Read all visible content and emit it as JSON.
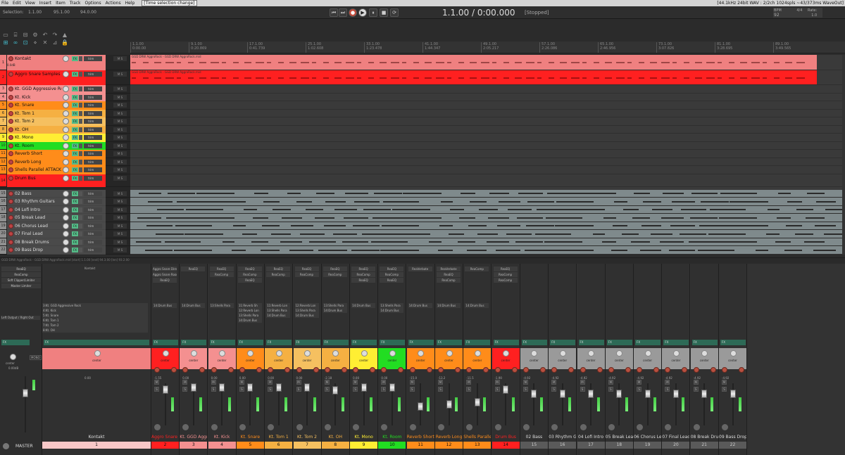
{
  "menubar": {
    "items": [
      "File",
      "Edit",
      "View",
      "Insert",
      "Item",
      "Track",
      "Options",
      "Actions",
      "Help"
    ],
    "status": "[Time selection change]",
    "right_info": "[44.1kHz 24bit WAV : 2/2ch 1024spls ~43/373ms WaveOut]"
  },
  "transport": {
    "selection_label": "Selection:",
    "sel_start": "1.1.00",
    "sel_end": "95.1.00",
    "sel_length": "94.0.00",
    "time": "1.1.00 / 0:00.000",
    "state": "[Stopped]",
    "bpm_label": "BPM",
    "bpm": "92",
    "timesig": "4/4",
    "rate_label": "Rate:",
    "rate": "1.0"
  },
  "ruler": {
    "marks": [
      {
        "bar": "1.1.00",
        "time": "0:00.00"
      },
      {
        "bar": "9.1.00",
        "time": "0:20.869"
      },
      {
        "bar": "17.1.00",
        "time": "0:41.739"
      },
      {
        "bar": "25.1.00",
        "time": "1:02.608"
      },
      {
        "bar": "33.1.00",
        "time": "1:23.478"
      },
      {
        "bar": "41.1.00",
        "time": "1:44.347"
      },
      {
        "bar": "49.1.00",
        "time": "2:05.217"
      },
      {
        "bar": "57.1.00",
        "time": "2:26.086"
      },
      {
        "bar": "65.1.00",
        "time": "2:46.956"
      },
      {
        "bar": "73.1.00",
        "time": "3:07.826"
      },
      {
        "bar": "81.1.00",
        "time": "3:28.695"
      },
      {
        "bar": "89.1.00",
        "time": "3:49.565"
      }
    ]
  },
  "tracks": [
    {
      "num": "1",
      "name": "Kontakt",
      "color": "#f08080",
      "sub": "0.0dB",
      "item": "GGD DRW AggroRock - GGD DRW AggroRock.mid"
    },
    {
      "num": "2",
      "name": "Aggro Snare Samples",
      "color": "#ff2020",
      "item": "GGD DRW AggroRock - GGD DRW AggroRock.mid"
    },
    {
      "num": "3",
      "name": "Kt. GGD Aggressive Rock",
      "color": "#f49090"
    },
    {
      "num": "4",
      "name": "Kt. Kick",
      "color": "#f49090"
    },
    {
      "num": "5",
      "name": "Kt. Snare",
      "color": "#ff8c1a"
    },
    {
      "num": "6",
      "name": "Kt. Tom 1",
      "color": "#f5b042"
    },
    {
      "num": "7",
      "name": "Kt. Tom 2",
      "color": "#f5c060"
    },
    {
      "num": "8",
      "name": "Kt. OH",
      "color": "#f5b042"
    },
    {
      "num": "9",
      "name": "Kt. Mono",
      "color": "#ffee33"
    },
    {
      "num": "10",
      "name": "Kt. Room",
      "color": "#22dd22"
    },
    {
      "num": "11",
      "name": "Reverb Short",
      "color": "#ff8c1a"
    },
    {
      "num": "12",
      "name": "Reverb Long",
      "color": "#ff8c1a"
    },
    {
      "num": "13",
      "name": "Shells Parallel ATTACK",
      "color": "#ff8c1a"
    },
    {
      "num": "14",
      "name": "Drum Bus",
      "color": "#ff2020"
    },
    {
      "num": "15",
      "name": "02 Bass",
      "color": "#8f8f8f"
    },
    {
      "num": "16",
      "name": "03 Rhythm Guitars",
      "color": "#8f8f8f"
    },
    {
      "num": "17",
      "name": "04 Lofi Intro",
      "color": "#8f8f8f"
    },
    {
      "num": "18",
      "name": "05 Break Lead",
      "color": "#8f8f8f"
    },
    {
      "num": "19",
      "name": "06 Chorus Lead",
      "color": "#8f8f8f"
    },
    {
      "num": "20",
      "name": "07 Final Lead",
      "color": "#8f8f8f"
    },
    {
      "num": "21",
      "name": "08 Break Drums",
      "color": "#8f8f8f"
    },
    {
      "num": "22",
      "name": "09 Bass Drop",
      "color": "#8f8f8f"
    }
  ],
  "track_controls": {
    "fx": "FX",
    "env": "trim",
    "ms": "M S"
  },
  "hscroll_text": "GGD DRW AggroRock - GGD DRW AggroRock.mid [start] 1.1.00 [end] 94.3.00 [len] 93.2.00",
  "mixer": {
    "master": {
      "fx": [
        "ReaEQ",
        "ReaComp",
        "Soft Clipper/Limiter",
        "Master Limiter"
      ],
      "output": "Left Output / Right Out",
      "fx_label": "FX",
      "pan": "center",
      "mono": "MONO",
      "vol": "0.00dB",
      "name": "MASTER"
    },
    "kontakt": {
      "sends": [
        "3:Kt. GGD Aggressive Rock",
        "4:Kt. Kick",
        "5:Kt. Snare",
        "6:Kt. Tom 1",
        "7:Kt. Tom 2",
        "8:Kt. OH"
      ],
      "vol": "0.00"
    },
    "strips": [
      {
        "name": "Aggro Snare S.",
        "num": "2",
        "fx": [
          "Aggro Snare Direc",
          "Aggro Snare Room",
          "ReaEQ"
        ],
        "sends": [
          "14:Drum Bus"
        ],
        "vol": "-1.55"
      },
      {
        "name": "Kt. GGD Aggre",
        "num": "3",
        "fx": [
          "ReaEQ"
        ],
        "sends": [
          "14:Drum Bus"
        ],
        "vol": "0.00"
      },
      {
        "name": "Kt. Kick",
        "num": "4",
        "fx": [
          "ReaEQ",
          "ReaComp"
        ],
        "sends": [
          "13:Shells Para"
        ],
        "vol": "0.00"
      },
      {
        "name": "Kt. Snare",
        "num": "5",
        "fx": [
          "ReaEQ",
          "ReaComp",
          "ReaEQ"
        ],
        "sends": [
          "11:Reverb Sh",
          "12:Reverb Lon",
          "13:Shells Para",
          "14:Drum Bus"
        ],
        "vol": "0.00"
      },
      {
        "name": "Kt. Tom 1",
        "num": "6",
        "fx": [
          "ReaEQ",
          "ReaComp"
        ],
        "sends": [
          "11:Reverb Lon",
          "13:Shells Para",
          "14:Drum Bus"
        ],
        "vol": "0.00"
      },
      {
        "name": "Kt. Tom 2",
        "num": "7",
        "fx": [
          "ReaEQ",
          "ReaComp"
        ],
        "sends": [
          "12:Reverb Lon",
          "13:Shells Para",
          "14:Drum Bus"
        ],
        "vol": "0.00"
      },
      {
        "name": "Kt. OH",
        "num": "8",
        "fx": [
          "ReaEQ",
          "ReaComp"
        ],
        "sends": [
          "13:Shells Para",
          "14:Drum Bus"
        ],
        "vol": "-2.18"
      },
      {
        "name": "Kt. Mono",
        "num": "9",
        "fx": [
          "ReaEQ",
          "ReaComp",
          "ReaEQ"
        ],
        "sends": [
          "14:Drum Bus"
        ],
        "vol": "0.00"
      },
      {
        "name": "Kt. Room",
        "num": "10",
        "fx": [
          "ReaEQ",
          "ReaComp",
          "ReaEQ"
        ],
        "sends": [
          "13:Shells Para",
          "14:Drum Bus"
        ],
        "vol": "0.00"
      },
      {
        "name": "Reverb Short",
        "num": "11",
        "fx": [
          "ReaVerbate"
        ],
        "sends": [
          "14:Drum Bus"
        ],
        "vol": "-15.0"
      },
      {
        "name": "Reverb Long",
        "num": "12",
        "fx": [
          "ReaVerbate",
          "ReaEQ",
          "ReaComp"
        ],
        "sends": [
          "14:Drum Bus"
        ],
        "vol": "-13.2"
      },
      {
        "name": "Shells Parallel",
        "num": "13",
        "fx": [
          "ReaComp"
        ],
        "sends": [
          "14:Drum Bus"
        ],
        "vol": "-11.5"
      },
      {
        "name": "Drum Bus",
        "num": "14",
        "fx": [
          "ReaEQ",
          "ReaComp",
          "ReaComp"
        ],
        "sends": [],
        "vol": "-1.90"
      },
      {
        "name": "02 Bass",
        "num": "15",
        "fx": [],
        "sends": [],
        "vol": "-4.92"
      },
      {
        "name": "03 Rhythm Gu",
        "num": "16",
        "fx": [],
        "sends": [],
        "vol": "-4.92"
      },
      {
        "name": "04 Lofi Intro",
        "num": "17",
        "fx": [],
        "sends": [],
        "vol": "-4.92"
      },
      {
        "name": "05 Break Lead",
        "num": "18",
        "fx": [],
        "sends": [],
        "vol": "-4.92"
      },
      {
        "name": "06 Chorus Lea",
        "num": "19",
        "fx": [],
        "sends": [],
        "vol": "-4.92"
      },
      {
        "name": "07 Final Lead",
        "num": "20",
        "fx": [],
        "sends": [],
        "vol": "-4.92"
      },
      {
        "name": "08 Break Drum",
        "num": "21",
        "fx": [],
        "sends": [],
        "vol": "-4.92"
      },
      {
        "name": "09 Bass Drop",
        "num": "22",
        "fx": [],
        "sends": [],
        "vol": "-4.92"
      }
    ]
  },
  "colors": {
    "pan_text": "center"
  }
}
